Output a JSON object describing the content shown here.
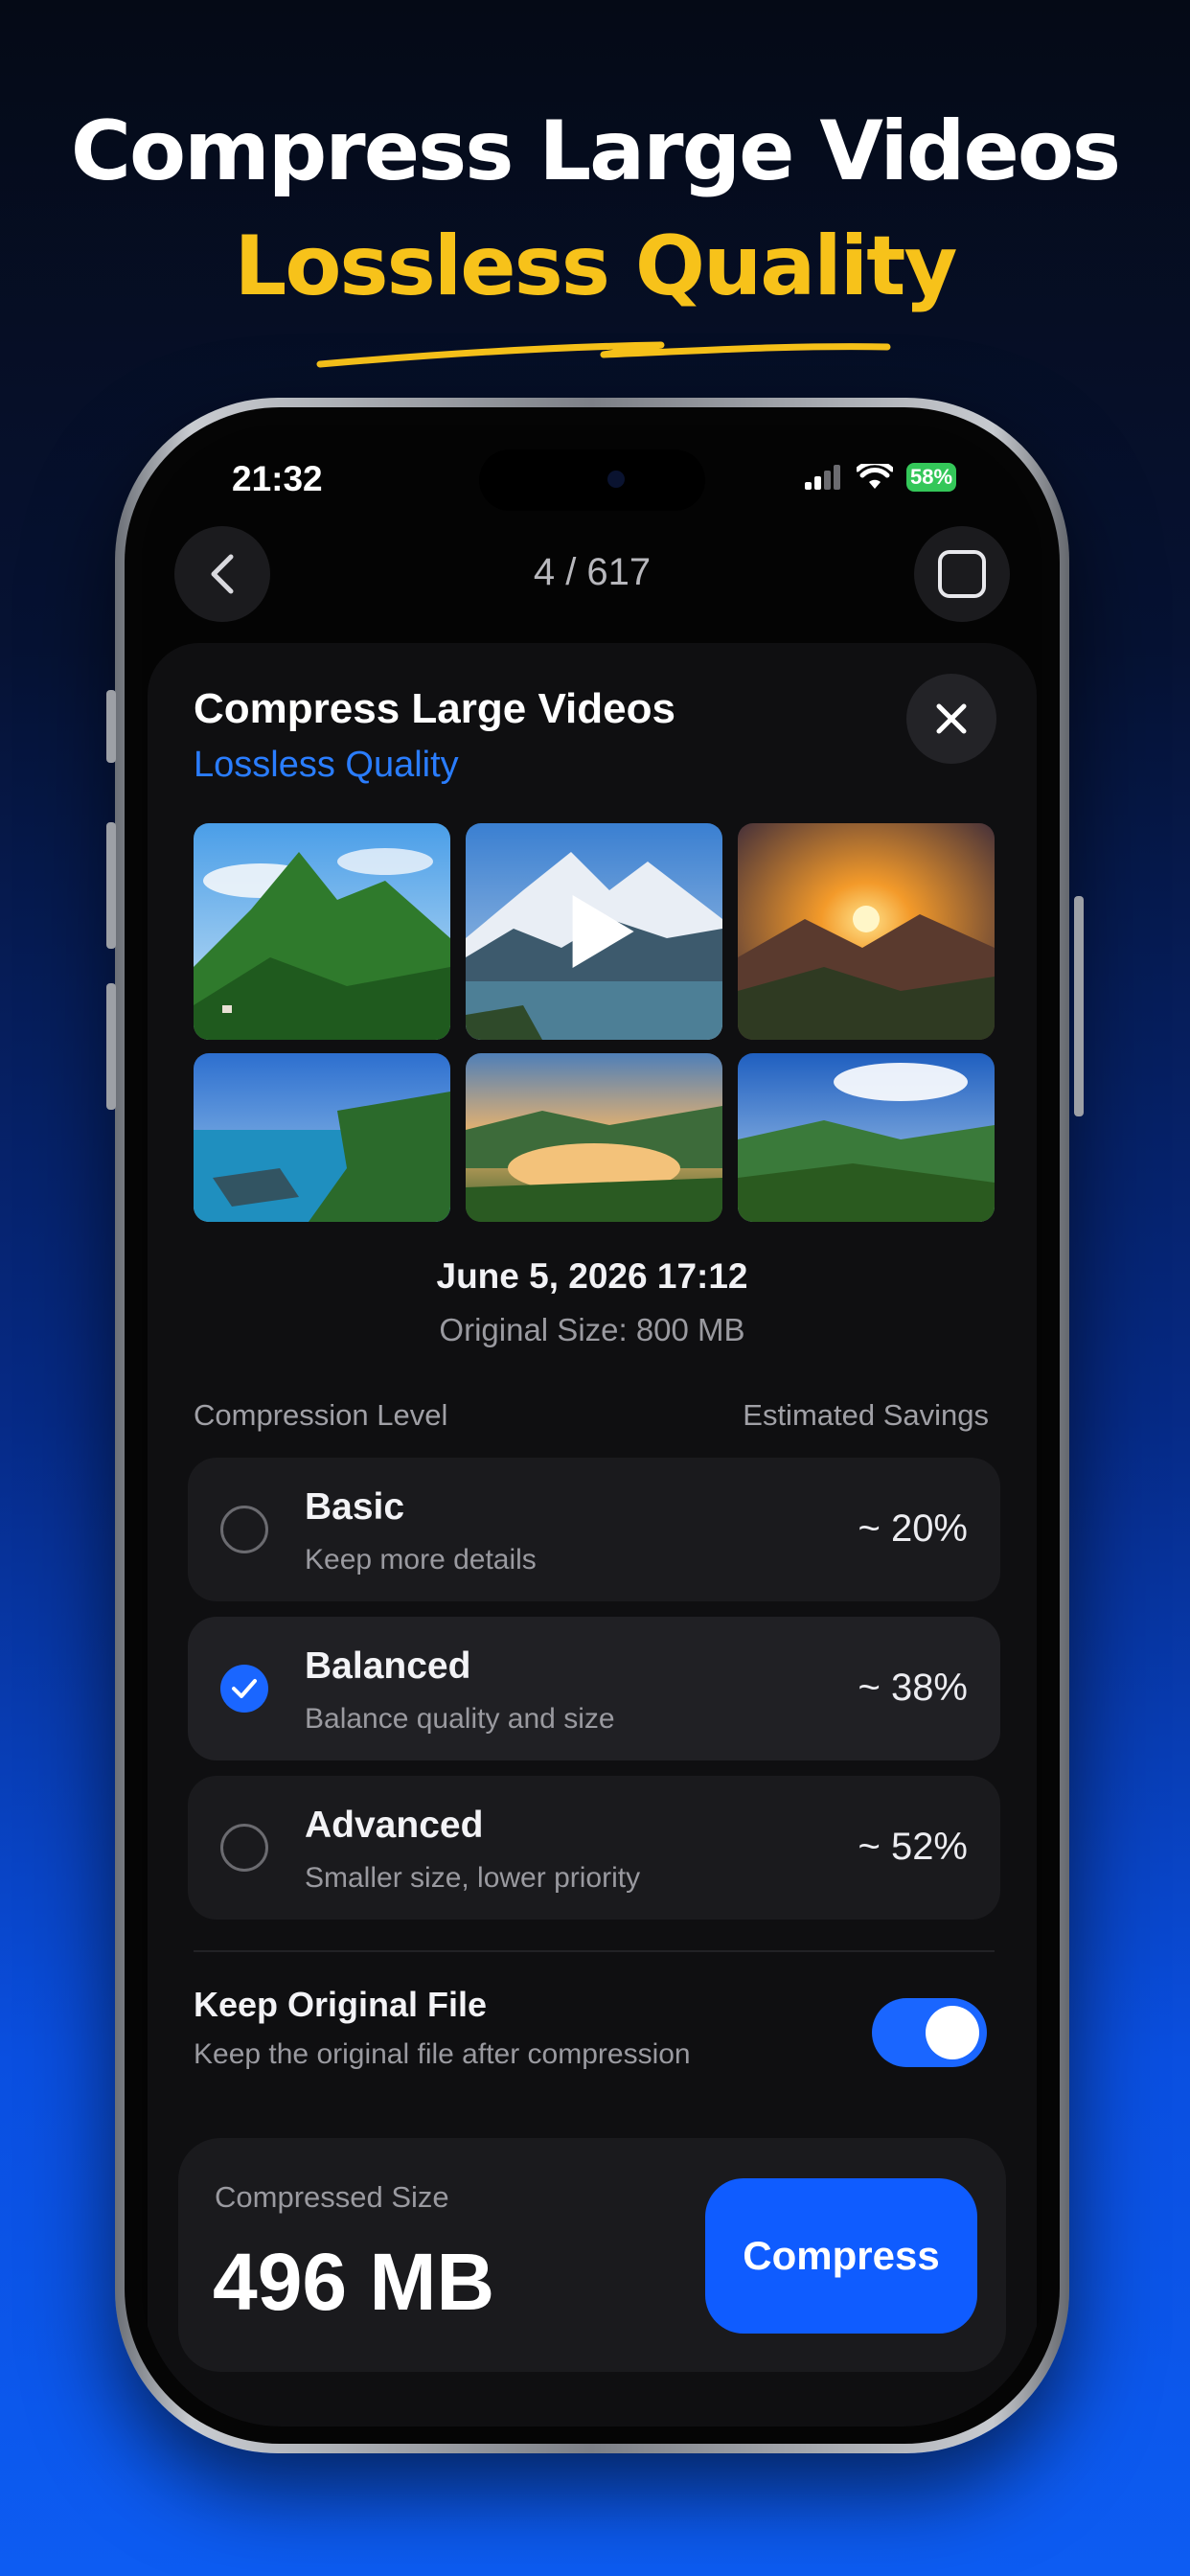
{
  "promo": {
    "headline": "Compress Large Videos",
    "subheadline": "Lossless Quality",
    "accent_color": "#f7c21a"
  },
  "status_bar": {
    "time": "21:32",
    "battery": "58%"
  },
  "nav": {
    "counter": "4 / 617"
  },
  "sheet": {
    "title": "Compress Large Videos",
    "subtitle": "Lossless Quality",
    "date": "June 5, 2026 17:12",
    "original_size": "Original Size: 800 MB",
    "compression_level_label": "Compression Level",
    "estimated_savings_label": "Estimated Savings",
    "options": [
      {
        "name": "Basic",
        "desc": "Keep more details",
        "savings": "~ 20%",
        "selected": false
      },
      {
        "name": "Balanced",
        "desc": "Balance quality and size",
        "savings": "~ 38%",
        "selected": true
      },
      {
        "name": "Advanced",
        "desc": "Smaller size, lower priority",
        "savings": "~ 52%",
        "selected": false
      }
    ],
    "keep_original": {
      "title": "Keep Original File",
      "desc": "Keep the original file after compression",
      "enabled": true
    },
    "compressed_size_label": "Compressed Size",
    "compressed_size_value": "496 MB",
    "compress_button": "Compress"
  },
  "colors": {
    "accent_blue": "#1a66ff",
    "battery_green": "#34c759"
  }
}
